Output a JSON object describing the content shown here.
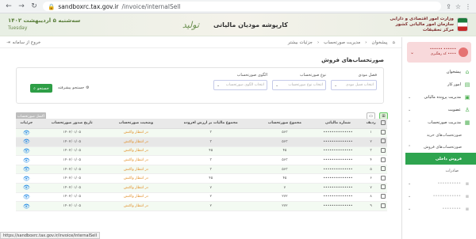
{
  "browser": {
    "host": "sandboxrc.tax.gov.ir",
    "path": "/invoice/internalSell"
  },
  "banner": {
    "date": "سه‌شنبه ۵ اردیبهشت ۱۴۰۲",
    "date_sub": "Tuesday",
    "calligraphy": "تولید",
    "title": "کارپوشه مودیان مالیاتی",
    "org_line1": "وزارت امور اقتصادی و دارایی",
    "org_line2": "سازمان امور مالیاتی کشور",
    "org_line3": "مرکز تحقیقات"
  },
  "topbar": {
    "exit": "خروج از سامانه",
    "breadcrumb": [
      "پیشخوان",
      "مدیریت صورتحساب",
      "جزئیات بیشتر"
    ]
  },
  "page": {
    "title": "صورتحساب‌های فروش"
  },
  "filters": {
    "invoice_type_label": "نوع صورتحساب",
    "invoice_type_placeholder": "انتخاب نوع صورتحساب",
    "pattern_label": "الگوی صورتحساب",
    "pattern_placeholder": "انتخاب الگوی صورتحساب",
    "period_label": "فصل مودی",
    "period_placeholder": "انتخاب فصل مودی",
    "search_button": "جستجو",
    "advanced_search": "جستجو پیشرفته"
  },
  "toolbar": {
    "export_button": "اکسل صورتحساب"
  },
  "table": {
    "headers": [
      "ردیف",
      "شماره مالیاتی",
      "مجموع صورتحساب",
      "مجموع مالیات بر ارزش افزوده",
      "وضعیت صورتحساب",
      "تاریخ صدور صورتحساب",
      "جزئیات"
    ],
    "rows": [
      {
        "idx": "۱",
        "taxno": "••••••••••••••",
        "total": "۵۶۳",
        "vat": "۳",
        "status": "در انتظار واکنش",
        "date": "۱۴۰۲/۰۱/۰۵"
      },
      {
        "idx": "۲",
        "taxno": "••••••••••••••",
        "total": "۵۶۳",
        "vat": "۳",
        "status": "در انتظار واکنش",
        "date": "۱۴۰۲/۰۱/۰۵"
      },
      {
        "idx": "۳",
        "taxno": "••••••••••••••",
        "total": "۴۵",
        "vat": "۴۵",
        "status": "در انتظار واکنش",
        "date": "۱۴۰۲/۰۱/۰۵"
      },
      {
        "idx": "۴",
        "taxno": "••••••••••••••",
        "total": "۵۶۳",
        "vat": "۳",
        "status": "در انتظار واکنش",
        "date": "۱۴۰۲/۰۱/۰۵"
      },
      {
        "idx": "۵",
        "taxno": "••••••••••••••",
        "total": "۵۶۳",
        "vat": "۳",
        "status": "در انتظار واکنش",
        "date": "۱۴۰۲/۰۱/۰۵"
      },
      {
        "idx": "۶",
        "taxno": "••••••••••••••",
        "total": "۴۵",
        "vat": "۴۵",
        "status": "در انتظار واکنش",
        "date": "۱۴۰۲/۰۱/۰۵"
      },
      {
        "idx": "۷",
        "taxno": "••••••••••••••",
        "total": "۷",
        "vat": "۷",
        "status": "در انتظار واکنش",
        "date": "۱۴۰۲/۰۱/۰۵"
      },
      {
        "idx": "۸",
        "taxno": "••••••••••••••",
        "total": "۲۷۲",
        "vat": "۲",
        "status": "در انتظار واکنش",
        "date": "۱۴۰۲/۰۱/۰۵"
      },
      {
        "idx": "۹",
        "taxno": "••••••••••••••",
        "total": "۲۷۲",
        "vat": "۲",
        "status": "در انتظار واکنش",
        "date": "۱۴۰۲/۰۱/۰۵"
      }
    ]
  },
  "statusbar": {
    "url": "https://sandboxrc.tax.gov.ir/invoice/internalSell"
  },
  "sidebar": {
    "user_line1": "•••••• ••••••",
    "user_line2": "کد رهگیری ••••",
    "items": [
      {
        "label": "پیشخوان",
        "icon": "⌂"
      },
      {
        "label": "امور کار",
        "icon": "▤"
      },
      {
        "label": "مدیریت پرونده مالیاتی",
        "icon": "▣"
      },
      {
        "label": "عضویت",
        "icon": "♙"
      },
      {
        "label": "مدیریت صورتحساب",
        "icon": "▦"
      }
    ],
    "sub_items": [
      "صورتحساب‌های خرید",
      "صورتحساب‌های فروش"
    ],
    "active_item": "فروش داخلی",
    "subsub_item": "صادرات",
    "grey_items": [
      "••••••••••",
      "••••••••••••",
      "••••••••"
    ]
  }
}
